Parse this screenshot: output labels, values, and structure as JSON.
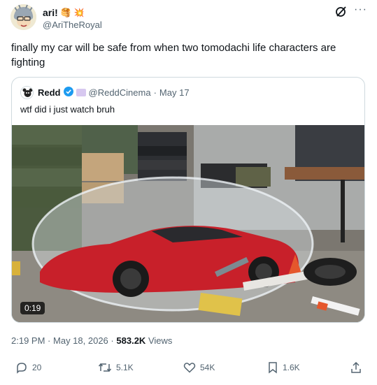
{
  "tweet": {
    "display_name": "ari!",
    "name_emojis": [
      "🥞",
      "💥"
    ],
    "handle": "@AriTheRoyal",
    "text": "finally my car will be safe from when two tomodachi life characters are fighting",
    "more_label": "···"
  },
  "quote": {
    "display_name": "Redd",
    "handle": "@ReddCinema",
    "separator": "·",
    "date": "May 17",
    "text": "wtf did i just watch bruh",
    "video_duration": "0:19"
  },
  "meta": {
    "time": "2:19 PM",
    "separator": "·",
    "date": "May 18, 2026",
    "separator2": "·",
    "views_count": "583.2K",
    "views_label": "Views"
  },
  "actions": {
    "replies": "20",
    "reposts": "5.1K",
    "likes": "54K",
    "bookmarks": "1.6K"
  },
  "colors": {
    "text_primary": "#0f1419",
    "text_secondary": "#536471",
    "border": "#cfd9de",
    "verified": "#1d9bf0",
    "car_red": "#c8202a"
  },
  "icons": [
    "grok-icon",
    "more-icon",
    "verified-icon",
    "reply-icon",
    "repost-icon",
    "like-icon",
    "bookmark-icon",
    "share-icon"
  ]
}
